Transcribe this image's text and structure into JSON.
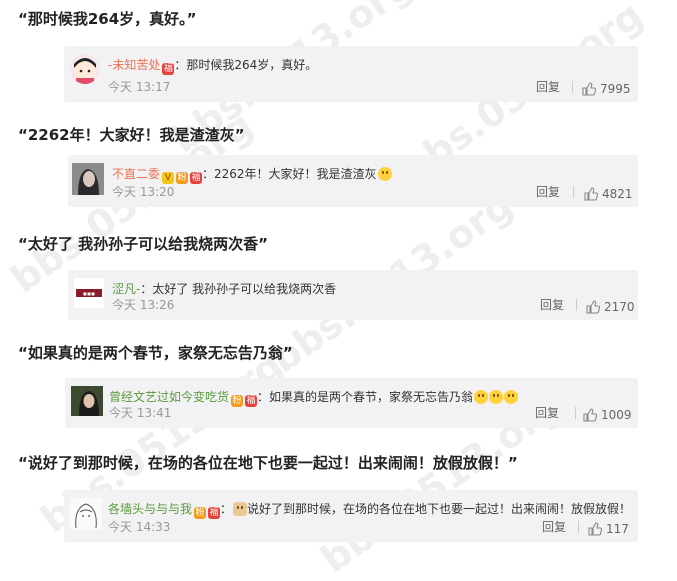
{
  "comments": [
    {
      "quote": "“那时候我264岁，真好。”",
      "username": "-未知苦处",
      "text": "：那时候我264岁，真好。",
      "time": "今天 13:17",
      "reply": "回复",
      "likes": "7995"
    },
    {
      "quote": "“2262年！大家好！我是渣渣灰”",
      "username": "不直二委",
      "text": "：2262年！大家好！我是渣渣灰",
      "time": "今天 13:20",
      "reply": "回复",
      "likes": "4821"
    },
    {
      "quote": "“太好了 我孙孙子可以给我烧两次香”",
      "username": "涩凡-",
      "text": "：太好了 我孙孙子可以给我烧两次香",
      "time": "今天 13:26",
      "reply": "回复",
      "likes": "2170"
    },
    {
      "quote": "“如果真的是两个春节，家祭无忘告乃翁”",
      "username": "曾经文艺过如今变吃货",
      "text": "：如果真的是两个春节，家祭无忘告乃翁",
      "time": "今天 13:41",
      "reply": "回复",
      "likes": "1009"
    },
    {
      "quote": "“说好了到那时候，在场的各位在地下也要一起过！出来闹闹！放假放假！”",
      "username": "各墙头与与与我",
      "text": "说好了到那时候，在场的各位在地下也要一起过！出来闹闹！放假放假！",
      "time": "今天 14:33",
      "reply": "回复",
      "likes": "117"
    }
  ],
  "watermark": "bbs.0513.org",
  "colors": {
    "username": "#eb7350",
    "card_bg": "#f2f2f5",
    "quote": "#222222"
  }
}
